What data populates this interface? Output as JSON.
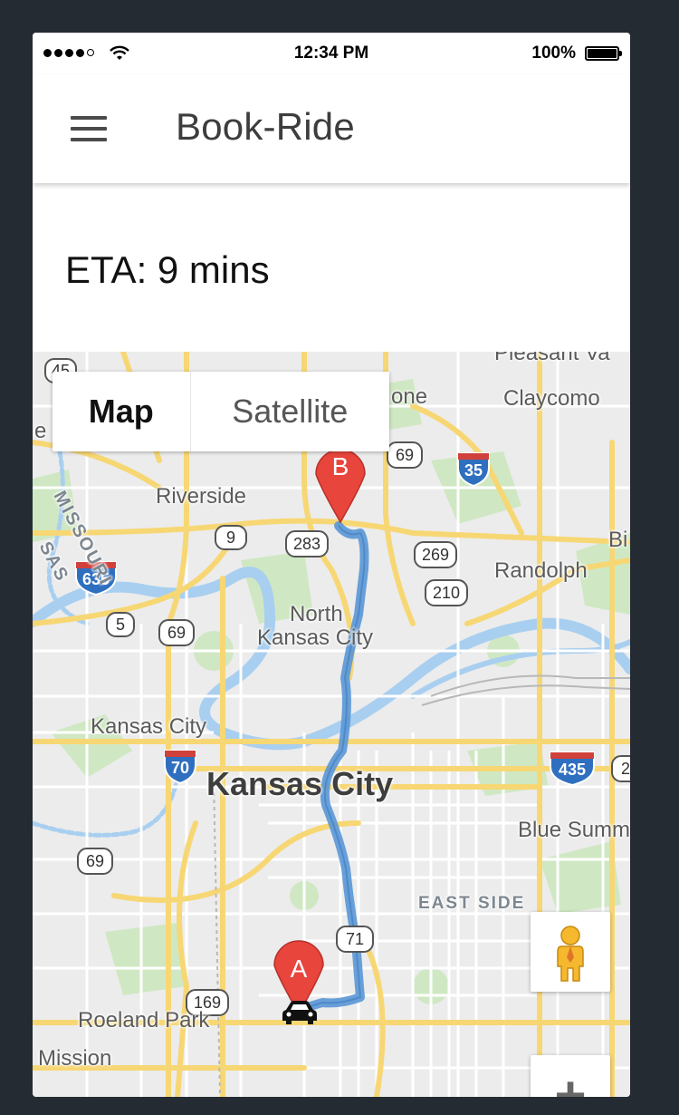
{
  "status_bar": {
    "time": "12:34 PM",
    "battery": "100%"
  },
  "app_bar": {
    "title": "Book-Ride"
  },
  "eta": {
    "text": "ETA: 9 mins"
  },
  "map": {
    "type_control": {
      "map_label": "Map",
      "satellite_label": "Satellite"
    },
    "markers": {
      "start": "A",
      "destination": "B"
    },
    "place_labels": {
      "pleasant_valley": "Pleasant Va",
      "claycomo": "Claycomo",
      "one": "one",
      "riverside": "Riverside",
      "randolph": "Randolph",
      "bi": "Bi",
      "north_kc_1": "North",
      "north_kc_2": "Kansas City",
      "kansas_city_ks": "Kansas City",
      "kansas_city": "Kansas City",
      "blue_summit": "Blue Summ",
      "east_side": "EAST SIDE",
      "roeland_park": "Roeland Park",
      "mission": "Mission",
      "missouri": "MISSOURI",
      "sas": "SAS",
      "e": "e"
    },
    "route_shields": {
      "i45": "45",
      "us69_top": "69",
      "i35": "35",
      "r9": "9",
      "r283": "283",
      "r269": "269",
      "r210": "210",
      "i635": "635",
      "r5": "5",
      "us69_mid": "69",
      "i70": "70",
      "i435": "435",
      "us69_low": "69",
      "us71": "71",
      "us169": "169",
      "edge2": "2"
    },
    "colors": {
      "route": "#5a97d6",
      "road": "#f7d774",
      "river": "#a9cff0",
      "park": "#c9e6be",
      "marker": "#e8453c",
      "interstate": "#2f6fbf"
    }
  }
}
